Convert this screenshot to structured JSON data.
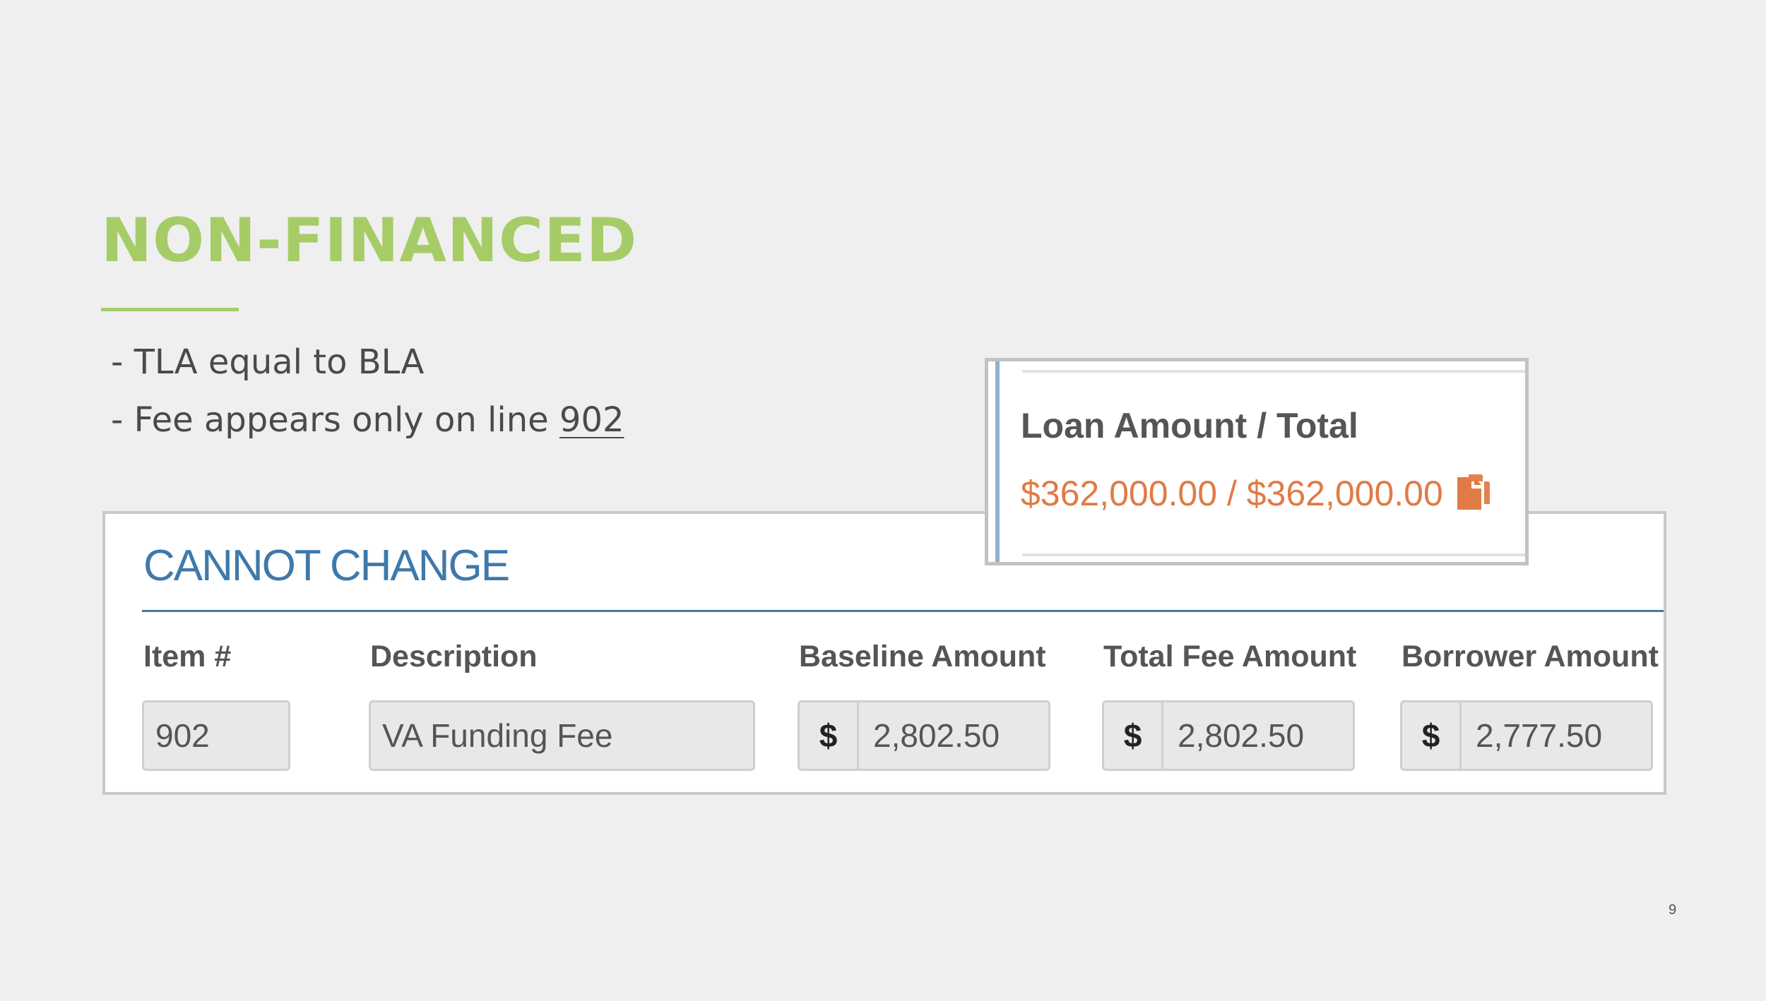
{
  "slide": {
    "title": "NON-FINANCED",
    "bullets": [
      "- TLA equal to BLA",
      "- Fee appears only on line "
    ],
    "bullet_link": "902",
    "page_number": "9"
  },
  "fee_panel": {
    "section_title": "CANNOT CHANGE",
    "columns": {
      "item": "Item #",
      "description": "Description",
      "baseline": "Baseline Amount",
      "total_fee": "Total Fee Amount",
      "borrower": "Borrower Amount"
    },
    "row": {
      "item": "902",
      "description": "VA Funding Fee",
      "currency": "$",
      "baseline": "2,802.50",
      "total_fee": "2,802.50",
      "borrower": "2,777.50"
    }
  },
  "loan_card": {
    "label": "Loan Amount / Total",
    "value": "$362,000.00 / $362,000.00",
    "icon": "copy-icon"
  },
  "colors": {
    "title_green": "#a6cc68",
    "section_blue": "#3e79ab",
    "value_orange": "#e07b45"
  }
}
